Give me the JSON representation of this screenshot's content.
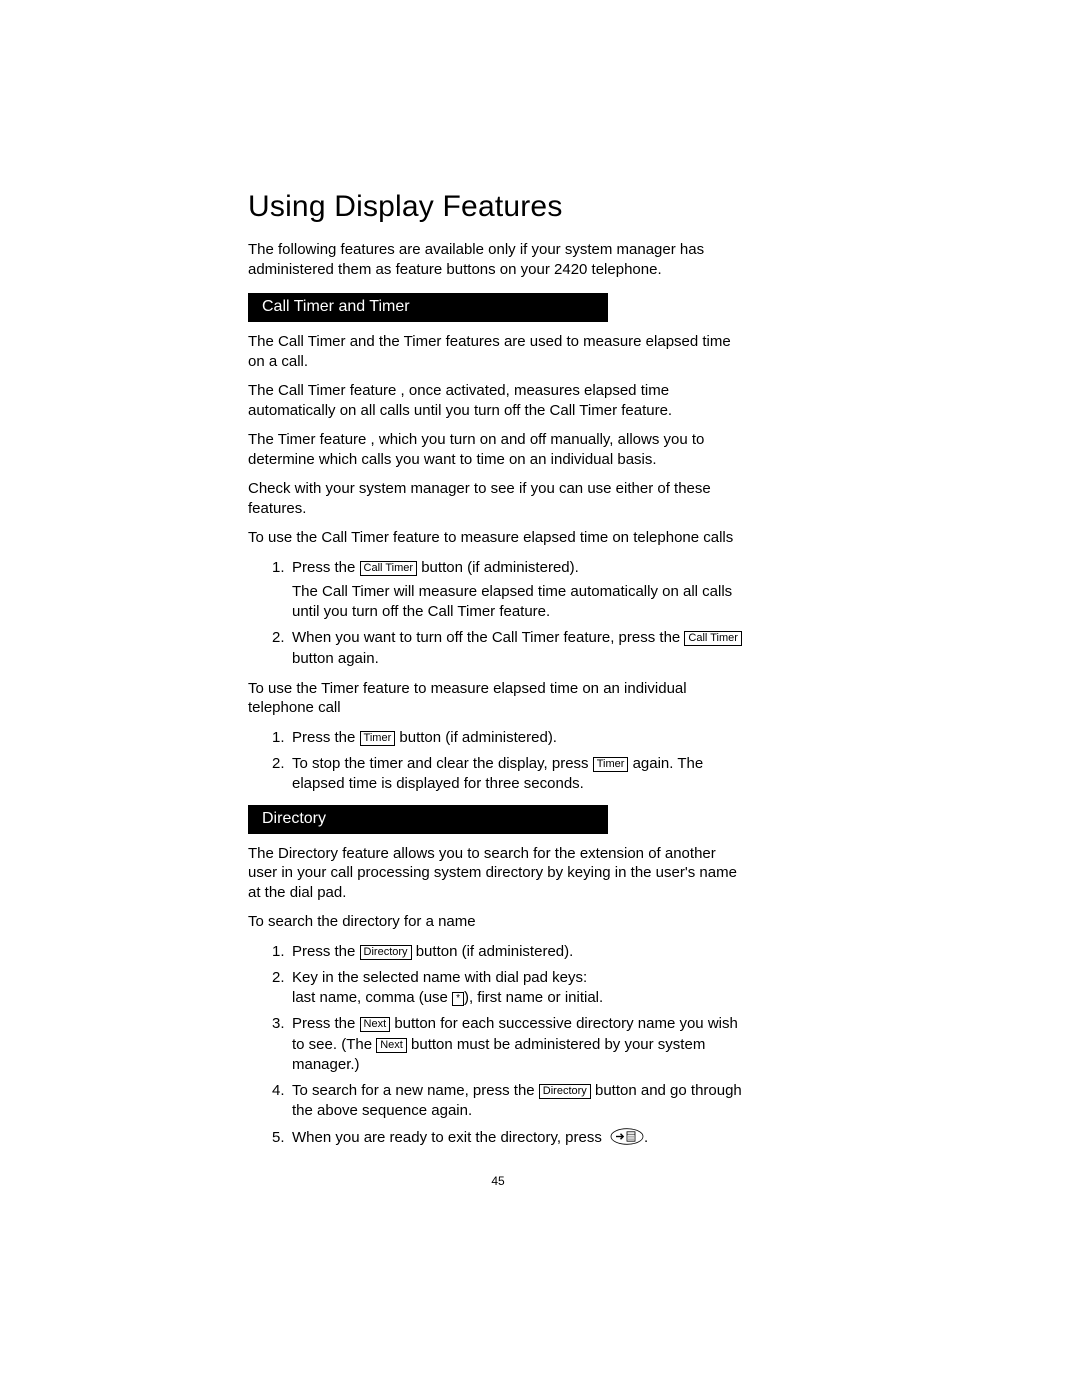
{
  "title": "Using Display Features",
  "intro": "The following features are available only if your system manager has administered them as feature buttons on your 2420 telephone.",
  "sections": {
    "callTimer": {
      "heading": "Call Timer and Timer",
      "p1": "The Call Timer and the Timer features are used to measure elapsed time on a call.",
      "p2": "The Call Timer feature , once activated, measures elapsed time automatically on all calls until you turn off the Call Timer feature.",
      "p3": "The Timer feature , which you turn on and off manually, allows you to determine which calls you want to time on an individual basis.",
      "p4": "Check with your system manager to see if you can use either of these features.",
      "p5": "To use the Call Timer feature to measure elapsed time on telephone calls",
      "list1": [
        {
          "num": "1.",
          "pre": "Press the ",
          "key": "Call Timer",
          "post": " button (if administered).",
          "sub": "The Call Timer will measure elapsed time automatically on all calls until you turn off the Call Timer feature."
        },
        {
          "num": "2.",
          "pre": "When you want to turn off the Call Timer feature, press the ",
          "key": "Call Timer",
          "post": " button again."
        }
      ],
      "p6": "To use the Timer feature to measure elapsed time on an individual telephone call",
      "list2": [
        {
          "num": "1.",
          "pre": "Press the ",
          "key": "Timer",
          "post": " button (if administered)."
        },
        {
          "num": "2.",
          "pre": "To stop the timer and clear the display, press ",
          "key": "Timer",
          "post": " again. The elapsed time is displayed for three seconds."
        }
      ]
    },
    "directory": {
      "heading": "Directory",
      "p1": "The Directory feature allows you to search for the extension of another user in your call processing system directory by keying in the user's name at the dial pad.",
      "p2": "To search the directory for a name",
      "list": [
        {
          "num": "1.",
          "pre": "Press the ",
          "key": "Directory",
          "post": " button (if administered)."
        },
        {
          "num": "2.",
          "text_a": "Key in the selected name with dial pad keys:",
          "text_b_pre": "last name, comma  (use ",
          "key": "*",
          "text_b_post": "), first name or initial."
        },
        {
          "num": "3.",
          "pre": "Press the ",
          "key": "Next",
          "post_a": " button for each successive directory name you wish to see. (The ",
          "key2": "Next",
          "post_b": " button must be administered by your system manager.)"
        },
        {
          "num": "4.",
          "pre": "To search for a new name, press the ",
          "key": "Directory",
          "post": " button and go through the above sequence again."
        },
        {
          "num": "5.",
          "pre": "When you are ready to exit the directory, press ",
          "post": "."
        }
      ]
    }
  },
  "pageNumber": "45"
}
